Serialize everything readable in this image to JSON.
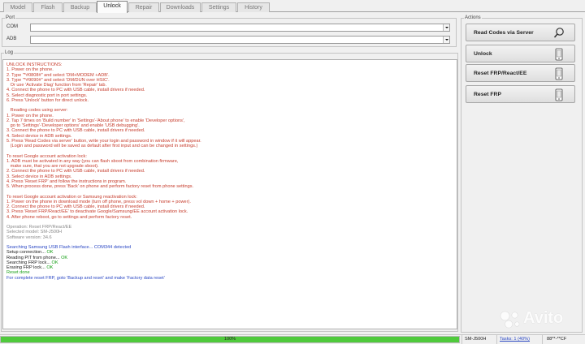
{
  "tabs": [
    {
      "label": "Model",
      "active": false
    },
    {
      "label": "Flash",
      "active": false
    },
    {
      "label": "Backup",
      "active": false
    },
    {
      "label": "Unlock",
      "active": true
    },
    {
      "label": "Repair",
      "active": false
    },
    {
      "label": "Downloads",
      "active": false
    },
    {
      "label": "Settings",
      "active": false
    },
    {
      "label": "History",
      "active": false
    }
  ],
  "port": {
    "title": "Port",
    "com_label": "COM",
    "adb_label": "ADB",
    "com_value": "",
    "adb_value": ""
  },
  "log": {
    "title": "Log",
    "lines": [
      {
        "text": "UNLOCK INSTRUCTIONS:",
        "color": "red"
      },
      {
        "text": "1. Power on the phone.",
        "color": "red"
      },
      {
        "text": "2. Type \"*#0808#\" and select 'DM+MODEM +ADB'.",
        "color": "red"
      },
      {
        "text": "3. Type \"*#9090#\" and select 'DM/DUN over HSIC'.",
        "color": "red"
      },
      {
        "text": "   Or use 'Activate Diag' function from 'Repair' tab.",
        "color": "red"
      },
      {
        "text": "4. Connect the phone to PC with USB cable, install drivers if needed.",
        "color": "red"
      },
      {
        "text": "5. Select diagnostic port in port settings.",
        "color": "red"
      },
      {
        "text": "6. Press 'Unlock' button for direct unlock.",
        "color": "red"
      },
      {
        "text": "",
        "color": "red"
      },
      {
        "text": "   Reading codes using server:",
        "color": "red"
      },
      {
        "text": "1. Power on the phone.",
        "color": "red"
      },
      {
        "text": "2. Tap 7 times on 'Build number' in 'Settings'-'About phone' to enable 'Developer options',",
        "color": "red"
      },
      {
        "text": "   go to 'Settings'-'Developer options' and enable 'USB debugging'.",
        "color": "red"
      },
      {
        "text": "3. Connect the phone to PC with USB cable, install drivers if needed.",
        "color": "red"
      },
      {
        "text": "4. Select device in ADB settings.",
        "color": "red"
      },
      {
        "text": "5. Press 'Read Codes via server' button, write your login and password in window if it will appear.",
        "color": "red"
      },
      {
        "text": "   (Login and password will be saved as default after first input and can be changed in settings.)",
        "color": "red"
      },
      {
        "text": "",
        "color": "red"
      },
      {
        "text": "To reset Google account activation lock:",
        "color": "red"
      },
      {
        "text": "1. ADB must be activated in any way (you can flash sboot from combination firmware,",
        "color": "red"
      },
      {
        "text": "   make sure, that you are not upgrade sboot).",
        "color": "red"
      },
      {
        "text": "2. Connect the phone to PC with USB cable, install drivers if needed.",
        "color": "red"
      },
      {
        "text": "3. Select device in ADB settings.",
        "color": "red"
      },
      {
        "text": "4. Press 'Reset FRP' and follow the instructions in program.",
        "color": "red"
      },
      {
        "text": "5. When process done, press 'Back' on phone and perform factory reset from phone settings.",
        "color": "red"
      },
      {
        "text": "",
        "color": "red"
      },
      {
        "text": "To reset Google account activation or Samsung reactivation lock:",
        "color": "red"
      },
      {
        "text": "1. Power on the phone in download mode (turn off phone, press vol down + home + power).",
        "color": "red"
      },
      {
        "text": "2. Connect the phone to PC with USB cable, install drivers if needed.",
        "color": "red"
      },
      {
        "text": "3. Press 'Reset FRP/React/EE' to deactivate Google/Samsung/EE account activation lock.",
        "color": "red"
      },
      {
        "text": "4. After phone reboot, go to settings and perform factory reset.",
        "color": "red"
      },
      {
        "text": "",
        "color": "red"
      },
      {
        "text": "Operation: Reset FRP/React/EE",
        "color": "gray"
      },
      {
        "text": "Selected model: SM-J500H",
        "color": "gray"
      },
      {
        "text": "Software version: 34.6",
        "color": "gray"
      },
      {
        "text": "",
        "color": "gray"
      },
      {
        "text": "Searching Samsung USB Flash interface... ",
        "color": "blue",
        "suffix": "COM344 detected",
        "suffix_color": "blue"
      },
      {
        "text": "Setup connection... ",
        "color": "black",
        "suffix": "OK",
        "suffix_color": "green"
      },
      {
        "text": "Reading PIT from phone... ",
        "color": "black",
        "suffix": "OK",
        "suffix_color": "green"
      },
      {
        "text": "Searching FRP lock... ",
        "color": "black",
        "suffix": "OK",
        "suffix_color": "green"
      },
      {
        "text": "Erasing FRP lock... ",
        "color": "black",
        "suffix": "OK",
        "suffix_color": "green"
      },
      {
        "text": "Reset done",
        "color": "green"
      },
      {
        "text": "For complete reset FRP, goto 'Backup and reset' and make 'Factory data reset'",
        "color": "blue"
      }
    ]
  },
  "actions": {
    "title": "Actions",
    "buttons": [
      {
        "label": "Read Codes via Server",
        "icon": "magnifier-icon"
      },
      {
        "label": "Unlock",
        "icon": "phone-icon"
      },
      {
        "label": "Reset FRP/React/EE",
        "icon": "phone-icon"
      },
      {
        "label": "Reset FRP",
        "icon": "phone-icon"
      }
    ]
  },
  "statusbar": {
    "progress_text": "100%",
    "progress_value": 1.0,
    "model": "SM-J500H",
    "status": "Tasks: 1 (40%)",
    "extra": "88**-**CF"
  },
  "watermark": "Avito",
  "colors": {
    "red": "#c63b2b",
    "gray": "#8a8a8a",
    "black": "#1a1a1a",
    "blue": "#2a47c4",
    "green": "#18a018",
    "progress": "#4fca3c"
  }
}
